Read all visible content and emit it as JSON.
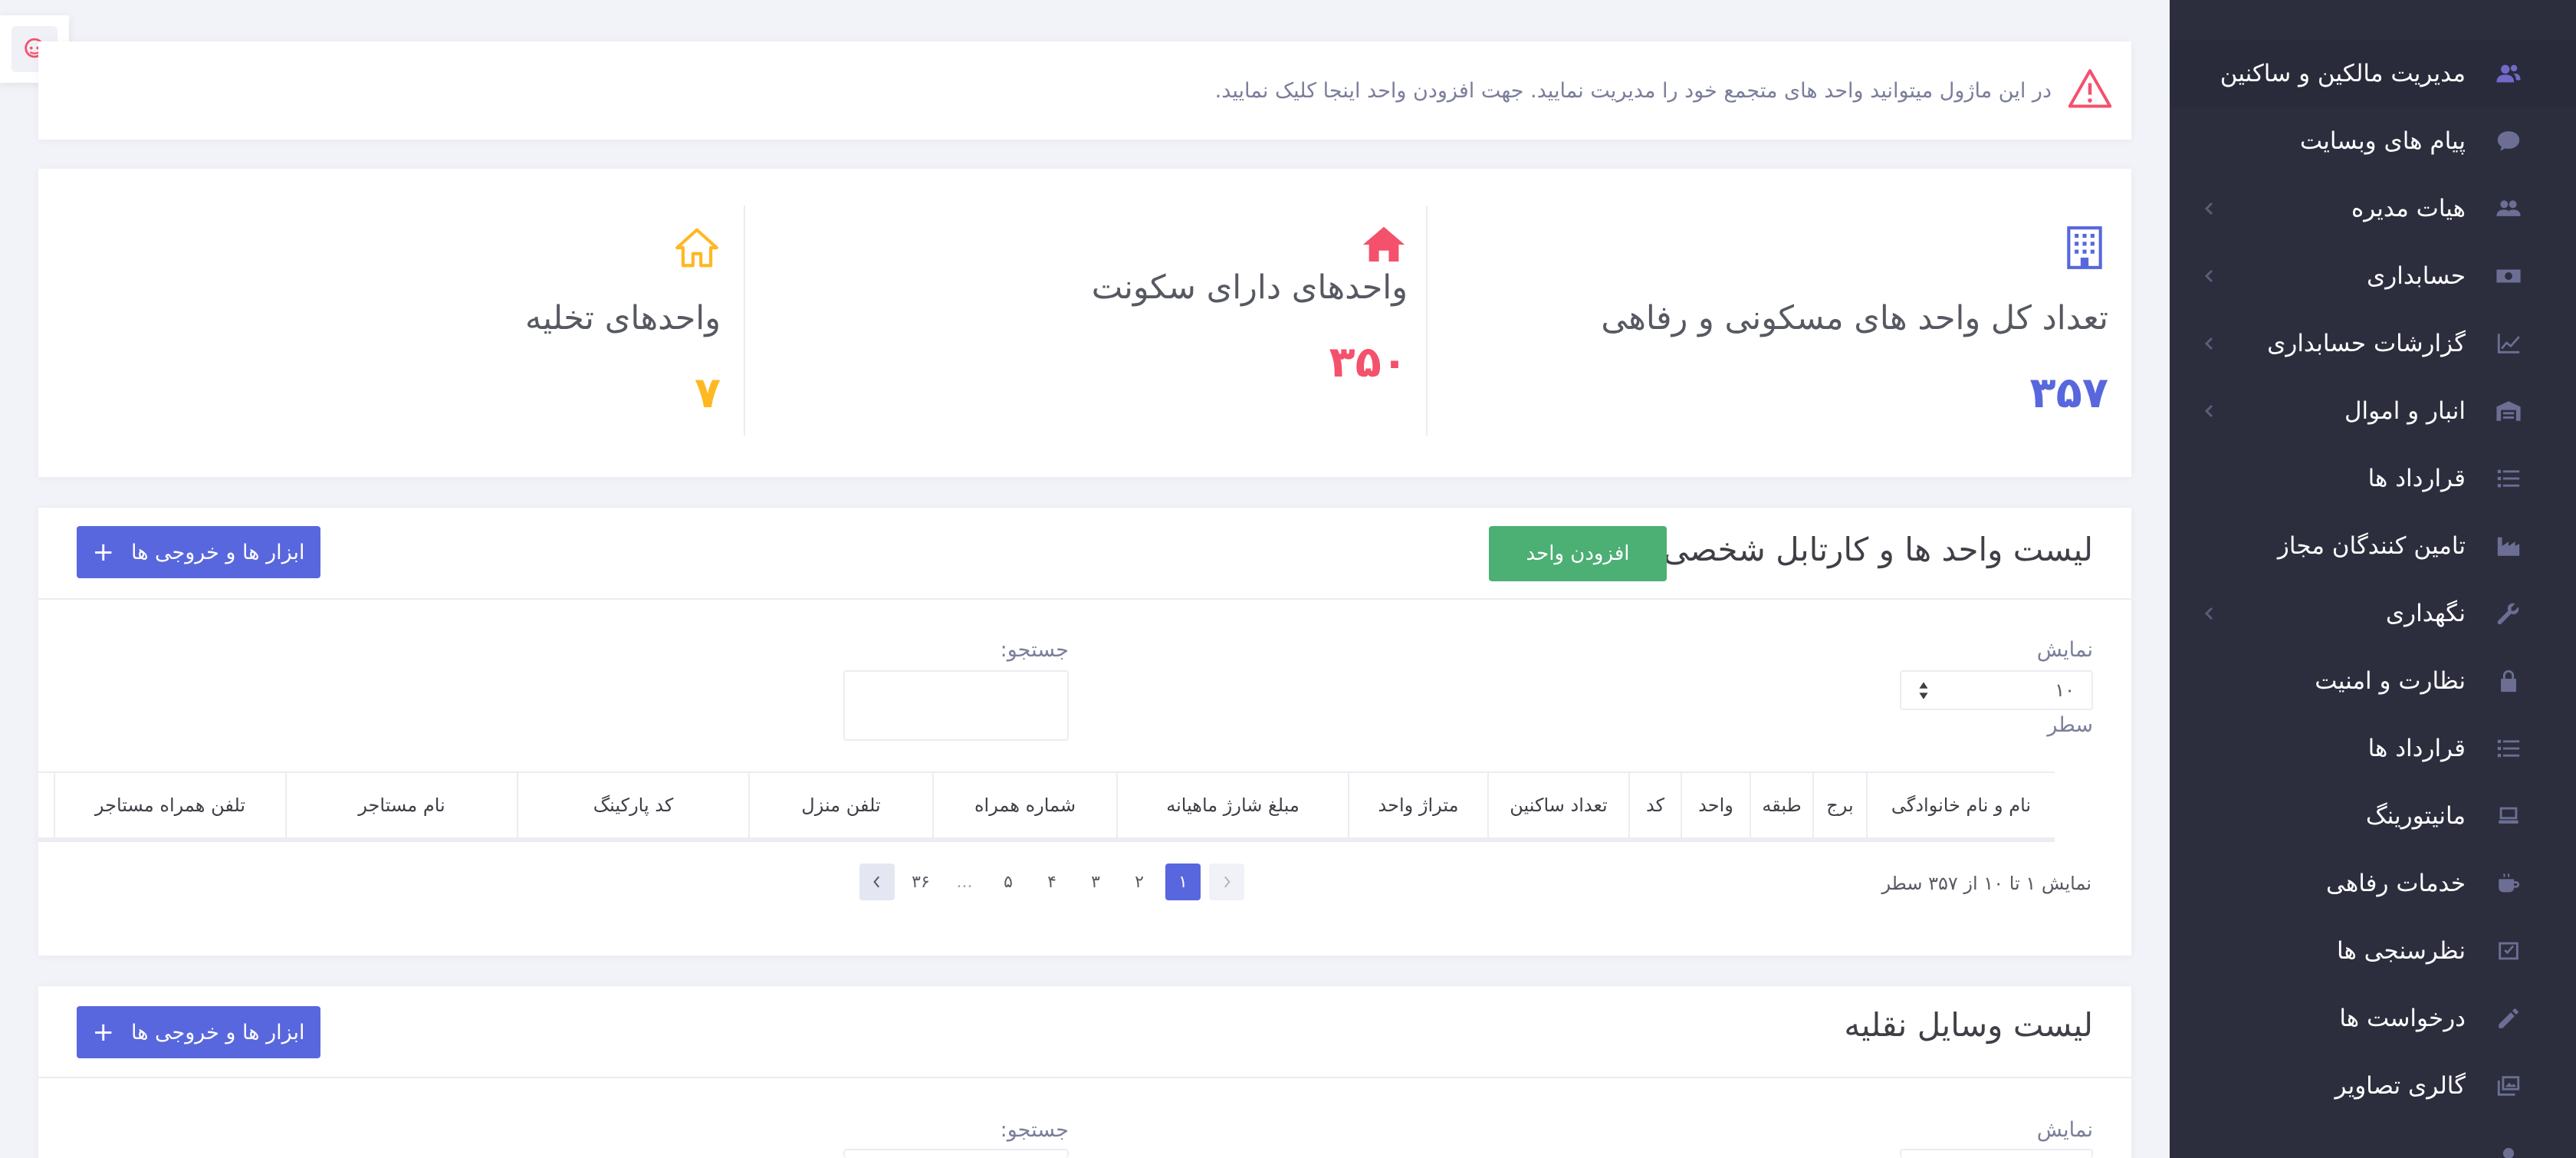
{
  "sidebar": {
    "items": [
      {
        "label": "مدیریت مالکین و ساکنین",
        "icon": "users-icon",
        "has_submenu": false
      },
      {
        "label": "پیام های وبسایت",
        "icon": "chat-icon",
        "has_submenu": false
      },
      {
        "label": "هیات مدیره",
        "icon": "group-icon",
        "has_submenu": true
      },
      {
        "label": "حسابداری",
        "icon": "money-icon",
        "has_submenu": true
      },
      {
        "label": "گزارشات حسابداری",
        "icon": "chart-line-icon",
        "has_submenu": true
      },
      {
        "label": "انبار و اموال",
        "icon": "warehouse-icon",
        "has_submenu": true
      },
      {
        "label": "قرارداد ها",
        "icon": "list-icon",
        "has_submenu": false
      },
      {
        "label": "تامین کنندگان مجاز",
        "icon": "industry-icon",
        "has_submenu": false
      },
      {
        "label": "نگهداری",
        "icon": "wrench-icon",
        "has_submenu": true
      },
      {
        "label": "نظارت و امنیت",
        "icon": "lock-icon",
        "has_submenu": false
      },
      {
        "label": "قرارداد ها",
        "icon": "list-icon",
        "has_submenu": false
      },
      {
        "label": "مانیتورینگ",
        "icon": "monitor-icon",
        "has_submenu": false
      },
      {
        "label": "خدمات رفاهی",
        "icon": "coffee-icon",
        "has_submenu": false
      },
      {
        "label": "نظرسنجی ها",
        "icon": "poll-icon",
        "has_submenu": false
      },
      {
        "label": "درخواست ها",
        "icon": "pencil-icon",
        "has_submenu": false
      },
      {
        "label": "گالری تصاویر",
        "icon": "images-icon",
        "has_submenu": false
      }
    ]
  },
  "alert": {
    "text": "در این ماژول میتوانید واحد های متجمع خود را مدیریت نمایید. جهت افزودن واحد اینجا کلیک نمایید.",
    "icon": "warning-icon",
    "color": "#f4516c"
  },
  "stats": {
    "total": {
      "title": "تعداد کل واحد های مسکونی و رفاهی",
      "value": "۳۵۷",
      "icon": "building-icon",
      "color": "#5867dd"
    },
    "occupied": {
      "title": "واحدهای دارای سکونت",
      "value": "۳۵۰",
      "icon": "home-icon",
      "color": "#f4516c"
    },
    "vacant": {
      "title": "واحدهای تخلیه",
      "value": "۷",
      "icon": "home-outline-icon",
      "color": "#ffb822"
    }
  },
  "units_portlet": {
    "title": "لیست واحد ها و کارتابل شخصی",
    "add_button": "افزودن واحد",
    "tools_button": "ابزار ها و خروجی ها",
    "show_label": "نمایش",
    "rows_label": "سطر",
    "page_size": "۱۰",
    "search_label": "جستجو:",
    "columns": [
      "نام و نام خانوادگی",
      "برج",
      "طبقه",
      "واحد",
      "کد",
      "تعداد ساکنین",
      "متراژ واحد",
      "مبلغ شارژ ماهیانه",
      "شماره همراه",
      "تلفن منزل",
      "کد پارکینگ",
      "نام مستاجر",
      "تلفن همراه مستاجر"
    ],
    "pager_info": "نمایش ۱ تا ۱۰ از ۳۵۷ سطر",
    "pages": [
      "۱",
      "۲",
      "۳",
      "۴",
      "۵",
      "...",
      "۳۶"
    ],
    "active_page": "۱"
  },
  "vehicles_portlet": {
    "title": "لیست وسایل نقلیه",
    "tools_button": "ابزار ها و خروجی ها",
    "show_label": "نمایش",
    "search_label": "جستجو:"
  },
  "colors": {
    "sidebar_bg": "#2c2e3e",
    "primary": "#5867dd",
    "success": "#4caf74",
    "danger": "#f4516c",
    "warning": "#ffb822"
  }
}
